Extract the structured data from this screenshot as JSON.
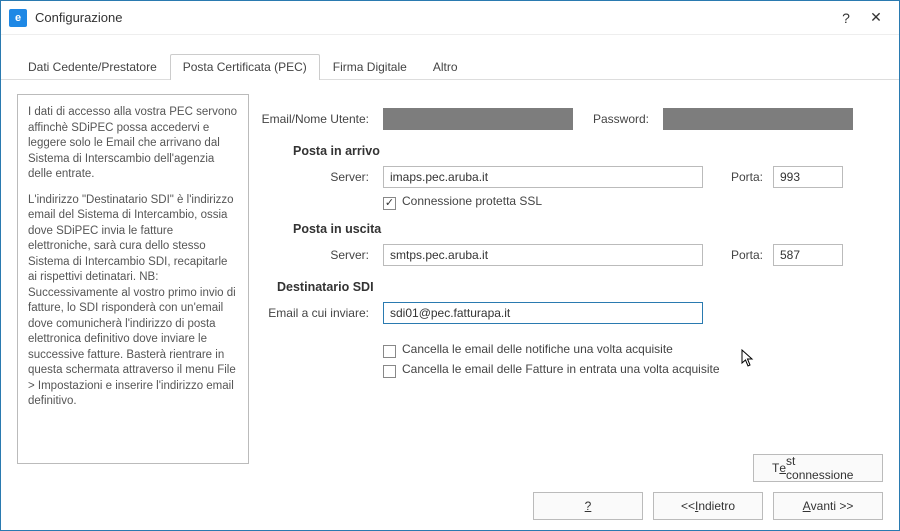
{
  "window": {
    "title": "Configurazione"
  },
  "tabs": {
    "t0": "Dati Cedente/Prestatore",
    "t1": "Posta Certificata (PEC)",
    "t2": "Firma Digitale",
    "t3": "Altro"
  },
  "info": {
    "p1": "I dati di accesso alla vostra PEC servono affinchè SDiPEC possa accedervi e leggere solo le Email che arrivano dal Sistema di Interscambio dell'agenzia delle entrate.",
    "p2": "L'indirizzo \"Destinatario SDI\" è l'indirizzo email del Sistema di Intercambio, ossia dove SDiPEC invia le fatture elettroniche, sarà cura dello stesso Sistema di Intercambio SDI, recapitarle ai rispettivi detinatari. NB: Successivamente al vostro primo invio di fatture, lo SDI risponderà con un'email dove comunicherà l'indirizzo di posta elettronica definitivo dove inviare le successive fatture. Basterà rientrare in questa schermata attraverso il menu File > Impostazioni e inserire l'indirizzo email definitivo."
  },
  "labels": {
    "email_user": "Email/Nome Utente:",
    "password": "Password:",
    "incoming_title": "Posta in arrivo",
    "server": "Server:",
    "port": "Porta:",
    "ssl": "Connessione protetta SSL",
    "outgoing_title": "Posta in uscita",
    "dest_title": "Destinatario SDI",
    "dest_email": "Email a cui inviare:",
    "del_notif": "Cancella le email delle notifiche una volta acquisite",
    "del_invoice": "Cancella le email delle Fatture in entrata una volta acquisite"
  },
  "values": {
    "email_user": "",
    "password": "",
    "in_server": "imaps.pec.aruba.it",
    "in_port": "993",
    "out_server": "smtps.pec.aruba.it",
    "out_port": "587",
    "dest_email": "sdi01@pec.fatturapa.it"
  },
  "buttons": {
    "test_conn_pre": "T",
    "test_conn_uline": "e",
    "test_conn_post": "st connessione",
    "help": "?",
    "back_pre": "<< ",
    "back_u": "I",
    "back_post": "ndietro",
    "fwd_u": "A",
    "fwd_post": "vanti >>"
  }
}
